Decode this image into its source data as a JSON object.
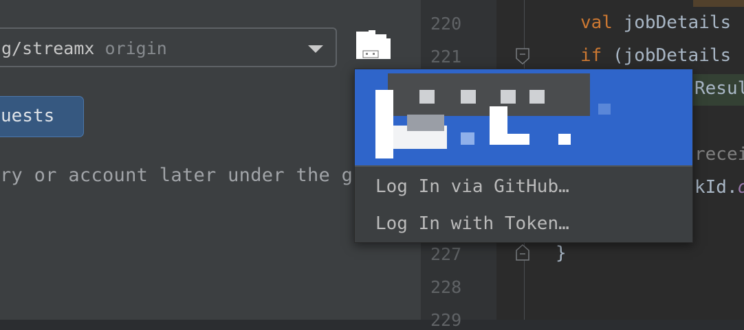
{
  "left_panel": {
    "repo_combo": {
      "repo": "g/streamx",
      "remote": "origin"
    },
    "requests_button": {
      "label": "uests"
    },
    "hint": "ry or account later under the g"
  },
  "editor": {
    "line_numbers": [
      "220",
      "221",
      "227",
      "228",
      "229"
    ],
    "lines": {
      "l220": {
        "keyword": "val",
        "text": " jobDetails"
      },
      "l221": {
        "keyword": "if",
        "text": " (jobDetails"
      },
      "l222": "Resul",
      "l224": "recei",
      "l225_a": "kId.",
      "l225_b": "or",
      "l227": "}"
    }
  },
  "popup": {
    "items": [
      "Log In via GitHub…",
      "Log In with Token…"
    ]
  },
  "colors": {
    "panel_bg": "#3c3f41",
    "editor_bg": "#2b2b2b",
    "selection": "#2f65ca",
    "button_bg": "#365880",
    "keyword": "#cc7832"
  }
}
